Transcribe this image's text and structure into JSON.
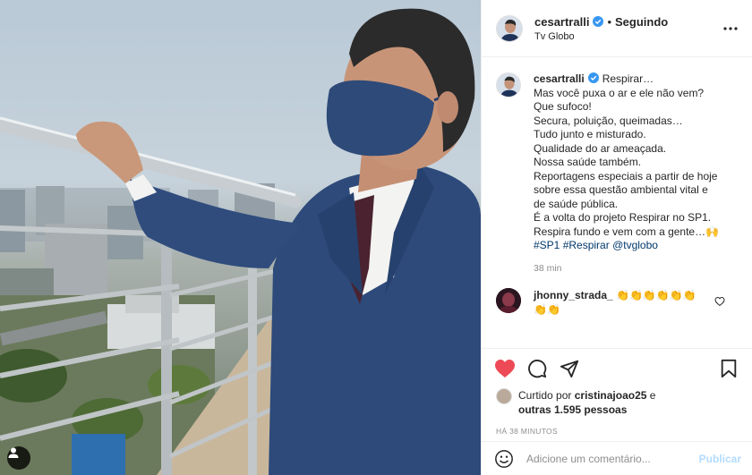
{
  "post": {
    "username": "cesartralli",
    "verified": true,
    "separator": "•",
    "follow_status": "Seguindo",
    "location": "Tv Globo"
  },
  "caption": {
    "username": "cesartralli",
    "lines": [
      "Respirar…",
      "Mas você puxa o ar e ele não vem?",
      "Que sufoco!",
      "Secura, poluição, queimadas…",
      "Tudo junto e misturado.",
      "Qualidade do ar ameaçada.",
      "Nossa saúde também.",
      "Reportagens especiais a partir de hoje",
      "sobre essa questão ambiental vital e",
      "de saúde pública.",
      "É a volta do projeto Respirar no SP1.",
      "Respira fundo e vem com a gente…🙌"
    ],
    "hashtags": [
      "#SP1",
      "#Respirar",
      "@tvglobo"
    ],
    "time_ago": "38 min"
  },
  "comments": [
    {
      "username": "jhonny_strada_",
      "text": "👏👏👏👏👏👏👏👏"
    }
  ],
  "actions": {
    "liked": true,
    "like_color": "#ed4956",
    "liked_by_prefix": "Curtido por",
    "liked_by_user": "cristinajoao25",
    "liked_by_mid": "e",
    "others_label": "outras 1.595 pessoas",
    "timestamp": "HÁ 38 MINUTOS"
  },
  "comment_box": {
    "placeholder": "Adicione um comentário...",
    "publish_label": "Publicar",
    "publish_color": "#b3dbff"
  },
  "icons": [
    "more-options-icon",
    "verified-icon",
    "heart-icon",
    "comment-icon",
    "share-icon",
    "save-icon",
    "emoji-icon",
    "tag-user-icon"
  ]
}
